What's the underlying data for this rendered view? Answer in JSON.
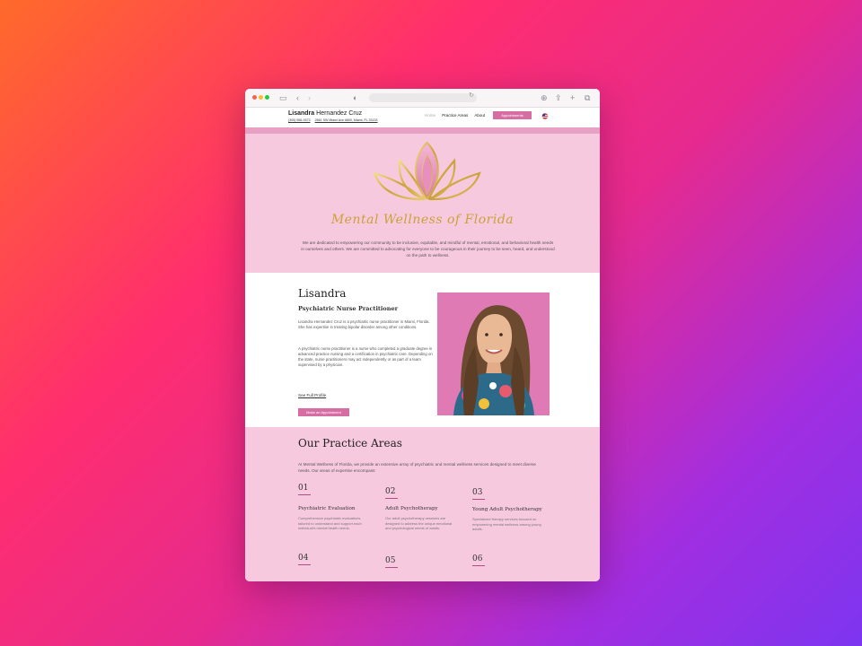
{
  "site": {
    "brand_first": "Lisandra",
    "brand_last": "Hernandez Cruz",
    "phone": "(305) 556-9373",
    "address": "2661 SW Miami Ave #800, Miami, FL 33133"
  },
  "nav": {
    "items": [
      "Home",
      "Practice Areas",
      "About"
    ],
    "appointment_button": "Appointments"
  },
  "hero": {
    "logo_text": "Mental Wellness of Florida",
    "mission": "We are dedicated to empowering our community to be inclusive, equitable, and mindful of mental, emotional, and behavioral health needs in ourselves and others. We are committed to advocating for everyone to be courageous in their journey to be seen, heard, and understood on the path to wellness."
  },
  "profile": {
    "name": "Lisandra",
    "title": "Psychiatric Nurse Practitioner",
    "bio1": "Lisandra Hernandez Cruz is a psychiatric nurse practitioner in Miami, Florida. She has expertise in treating bipolar disorder among other conditions.",
    "bio2": "A psychiatric nurse practitioner is a nurse who completed a graduate degree in advanced practice nursing and a certification in psychiatric care. Depending on the state, nurse practitioners may act independently or as part of a team supervised by a physician.",
    "full_profile_link": "See Full Profile",
    "appointment_button": "Make an Appointment"
  },
  "practice": {
    "heading": "Our Practice Areas",
    "description": "At Mental Wellness of Florida, we provide an extensive array of psychiatric and mental wellness services designed to meet diverse needs. Our areas of expertise encompass:",
    "areas": [
      {
        "num": "01",
        "title": "Psychiatric Evaluation",
        "text": "Comprehensive psychiatric evaluations tailored to understand and support each individual's mental health needs."
      },
      {
        "num": "02",
        "title": "Adult Psychotherapy",
        "text": "Our adult psychotherapy sessions are designed to address the unique emotional and psychological needs of adults."
      },
      {
        "num": "03",
        "title": "Young Adult Psychotherapy",
        "text": "Specialized therapy services focused on empowering mental wellness among young adults."
      },
      {
        "num": "04",
        "title": "",
        "text": ""
      },
      {
        "num": "05",
        "title": "",
        "text": ""
      },
      {
        "num": "06",
        "title": "",
        "text": ""
      }
    ]
  },
  "colors": {
    "accent_pink": "#d66ea4",
    "hero_bg": "#f7c9df",
    "gold": "#c9a23a"
  }
}
